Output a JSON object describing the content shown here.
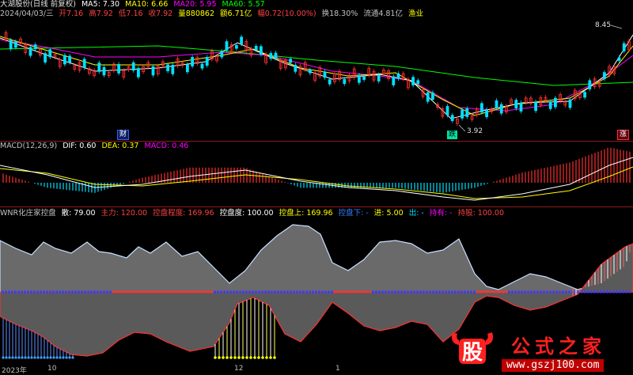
{
  "main_header": {
    "name": "大湖股份(日线 前复权)",
    "ma5": "MA5: 7.30",
    "ma10": "MA10: 6.66",
    "ma20": "MA20: 5.95",
    "ma60": "MA60: 5.57",
    "line2": {
      "date": "2024/04/03/三",
      "open": "开7.16",
      "high": "高7.92",
      "low": "低7.16",
      "close": "收7.92",
      "vol": "量880862",
      "amount": "额6.71亿",
      "change": "幅0.72(10.00%)",
      "turnover": "换18.30%",
      "float": "流通4.81亿",
      "industry": "渔业"
    }
  },
  "price_labels": {
    "high": "8.45",
    "low": "3.92"
  },
  "badges": {
    "cai": "财",
    "die": "跌",
    "zhang": "涨"
  },
  "macd_header": {
    "name": "MACD(12,26,9)",
    "dif": "DIF: 0.60",
    "dea": "DEA: 0.37",
    "macd": "MACD: 0.46"
  },
  "wnr_header": {
    "name": "WNR化庄家控盘",
    "san": "散: 79.00",
    "zhuli": "主力: 120.00",
    "kongpan_cd": "控盘程度: 169.96",
    "kongpan_du": "控盘度: 100.00",
    "kongpan_up": "控盘上: 169.96",
    "kongpan_down": "控盘下: -",
    "jin": "进: 5.00",
    "chu": "出: -",
    "chiyou": "持有: -",
    "chigu": "持股: 100.00"
  },
  "x_axis": {
    "year": "2023年",
    "m10": "10",
    "m12": "12",
    "m1": "1"
  },
  "watermark": {
    "cn": "公式之家",
    "url": "www.gszj100.com",
    "icon_text": "股"
  },
  "colors": {
    "ma5": "#ffffff",
    "ma10": "#ffff00",
    "ma20": "#ff00ff",
    "ma60": "#00ff00",
    "up": "#ff3030",
    "down": "#00e0ff",
    "gray_fill": "#6a6a6a",
    "sep": "#8b1a1a"
  }
}
